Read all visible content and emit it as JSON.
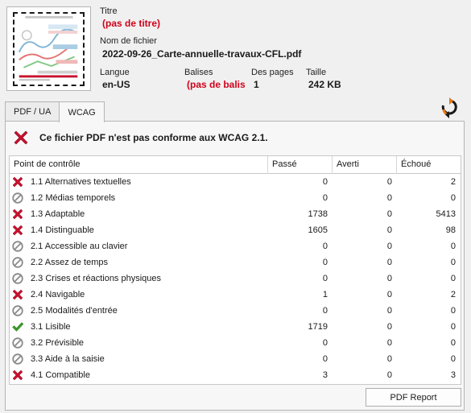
{
  "header": {
    "title_label": "Titre",
    "title_value": "(pas de titre)",
    "filename_label": "Nom de fichier",
    "filename_value": "2022-09-26_Carte-annuelle-travaux-CFL.pdf",
    "language_label": "Langue",
    "language_value": "en-US",
    "tags_label": "Balises",
    "tags_value": "(pas de balis",
    "pages_label": "Des pages",
    "pages_value": "1",
    "size_label": "Taille",
    "size_value": "242 KB"
  },
  "tabs": [
    {
      "label": "PDF / UA"
    },
    {
      "label": "WCAG"
    }
  ],
  "status": {
    "message": "Ce fichier PDF n'est pas conforme aux WCAG 2.1."
  },
  "table": {
    "columns": [
      "Point de contrôle",
      "Passé",
      "Averti",
      "Échoué"
    ],
    "rows": [
      {
        "icon": "fail",
        "label": "1.1 Alternatives textuelles",
        "passed": "0",
        "warned": "0",
        "failed": "2"
      },
      {
        "icon": "na",
        "label": "1.2 Médias temporels",
        "passed": "0",
        "warned": "0",
        "failed": "0"
      },
      {
        "icon": "fail",
        "label": "1.3 Adaptable",
        "passed": "1738",
        "warned": "0",
        "failed": "5413"
      },
      {
        "icon": "fail",
        "label": "1.4 Distinguable",
        "passed": "1605",
        "warned": "0",
        "failed": "98"
      },
      {
        "icon": "na",
        "label": "2.1 Accessible au clavier",
        "passed": "0",
        "warned": "0",
        "failed": "0"
      },
      {
        "icon": "na",
        "label": "2.2 Assez de temps",
        "passed": "0",
        "warned": "0",
        "failed": "0"
      },
      {
        "icon": "na",
        "label": "2.3 Crises et réactions physiques",
        "passed": "0",
        "warned": "0",
        "failed": "0"
      },
      {
        "icon": "fail",
        "label": "2.4 Navigable",
        "passed": "1",
        "warned": "0",
        "failed": "2"
      },
      {
        "icon": "na",
        "label": "2.5 Modalités d'entrée",
        "passed": "0",
        "warned": "0",
        "failed": "0"
      },
      {
        "icon": "pass",
        "label": "3.1 Lisible",
        "passed": "1719",
        "warned": "0",
        "failed": "0"
      },
      {
        "icon": "na",
        "label": "3.2 Prévisible",
        "passed": "0",
        "warned": "0",
        "failed": "0"
      },
      {
        "icon": "na",
        "label": "3.3 Aide à la saisie",
        "passed": "0",
        "warned": "0",
        "failed": "0"
      },
      {
        "icon": "fail",
        "label": "4.1 Compatible",
        "passed": "3",
        "warned": "0",
        "failed": "3"
      }
    ]
  },
  "footer": {
    "report_button": "PDF Report"
  },
  "colors": {
    "error_red": "#d0021b",
    "fail_icon": "#c8102e",
    "pass_icon": "#3a9b28",
    "na_icon": "#8a8a8a",
    "refresh_orange": "#e8780f"
  }
}
